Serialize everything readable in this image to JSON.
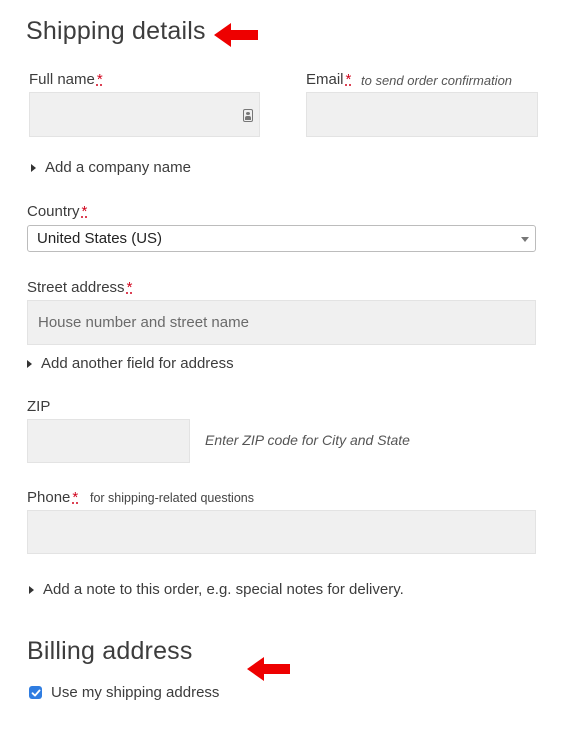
{
  "shipping": {
    "title": "Shipping details",
    "full_name_label": "Full name",
    "email_label": "Email",
    "email_hint": "to send order confirmation",
    "company_toggle": "Add a company name",
    "country_label": "Country",
    "country_value": "United States (US)",
    "street_label": "Street address",
    "street_placeholder": "House number and street name",
    "address_toggle": "Add another field for address",
    "zip_label": "ZIP",
    "zip_hint": "Enter ZIP code for City and State",
    "phone_label": "Phone",
    "phone_hint": "for shipping-related questions",
    "note_toggle": "Add a note to this order, e.g. special notes for delivery.",
    "required_marker": "*"
  },
  "billing": {
    "title": "Billing address",
    "use_shipping_label": "Use my shipping address",
    "use_shipping_checked": true
  },
  "colors": {
    "required": "#d0021b",
    "arrow": "#ee0000",
    "checkbox": "#2f7de1",
    "field_bg": "#f0f0f0"
  },
  "icons": {
    "contact_card": "contact-card-icon",
    "dropdown": "dropdown-caret-icon",
    "arrows": "red-left-arrow-icon"
  }
}
